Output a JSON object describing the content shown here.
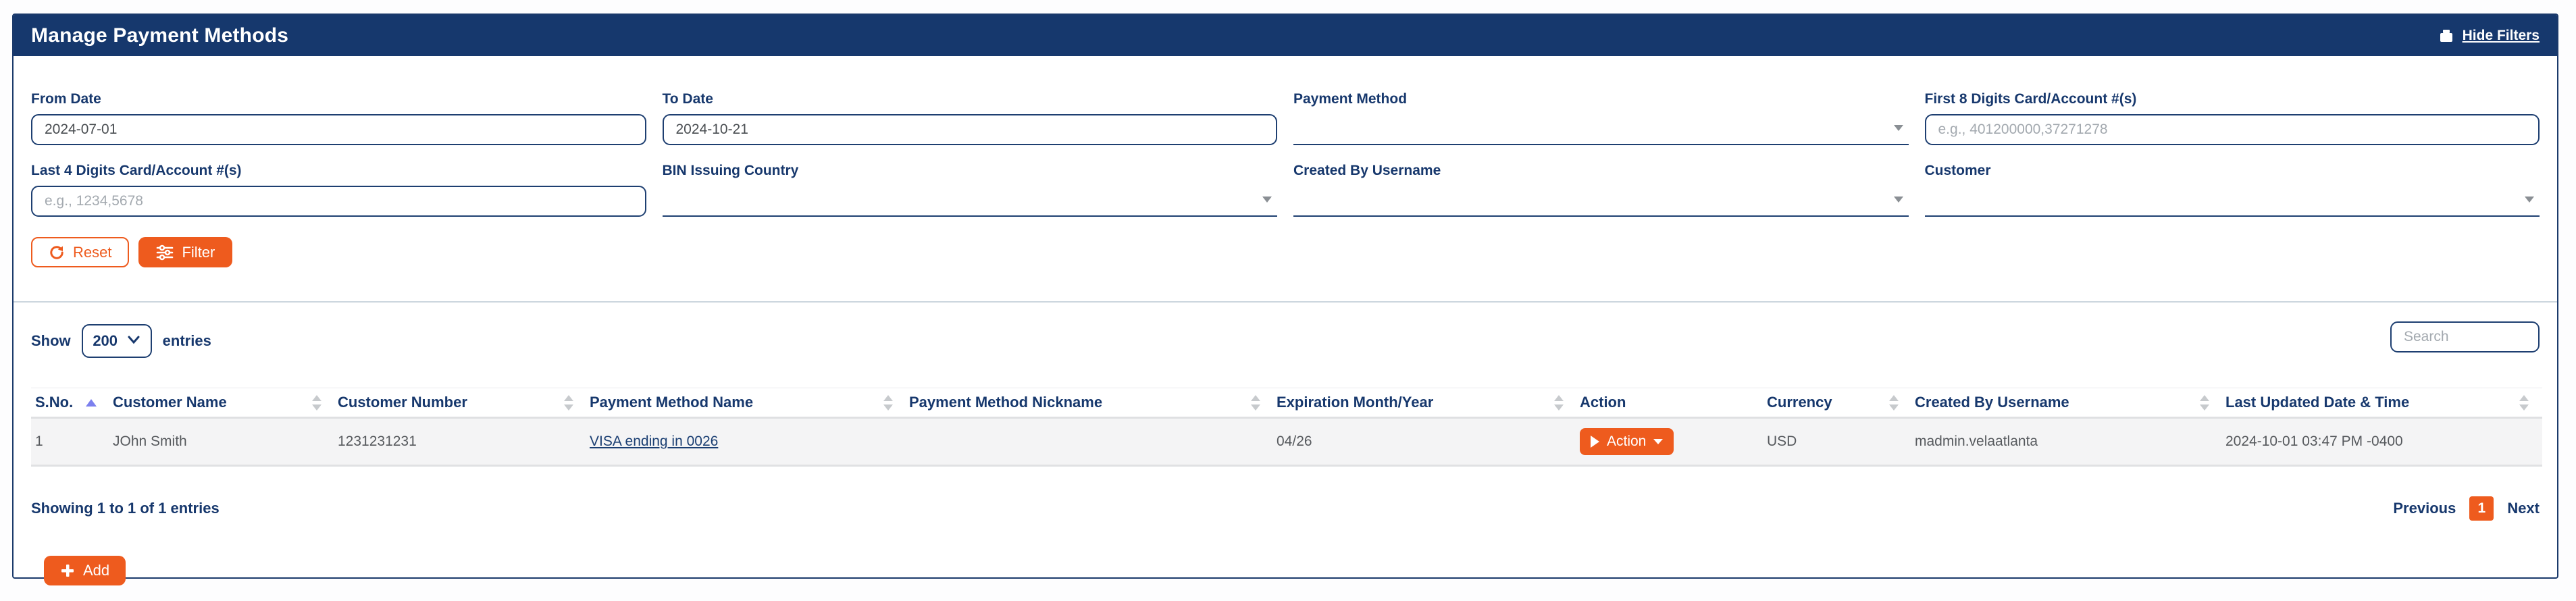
{
  "header": {
    "title": "Manage Payment Methods",
    "hide_filters_label": "Hide Filters"
  },
  "filters": {
    "fields": [
      {
        "label": "From Date",
        "type": "input",
        "value": "2024-07-01",
        "placeholder": ""
      },
      {
        "label": "To Date",
        "type": "input",
        "value": "2024-10-21",
        "placeholder": ""
      },
      {
        "label": "Payment Method",
        "type": "select",
        "value": ""
      },
      {
        "label": "First 8 Digits Card/Account #(s)",
        "type": "input",
        "value": "",
        "placeholder": "e.g., 401200000,37271278"
      },
      {
        "label": "Last 4 Digits Card/Account #(s)",
        "type": "input",
        "value": "",
        "placeholder": "e.g., 1234,5678"
      },
      {
        "label": "BIN Issuing Country",
        "type": "select",
        "value": ""
      },
      {
        "label": "Created By Username",
        "type": "select",
        "value": ""
      },
      {
        "label": "Customer",
        "type": "select",
        "value": ""
      }
    ],
    "reset_label": "Reset",
    "filter_label": "Filter"
  },
  "table_controls": {
    "show_label": "Show",
    "page_size": "200",
    "entries_label": "entries",
    "search_placeholder": "Search"
  },
  "table": {
    "columns": [
      {
        "label": "S.No.",
        "sort": "asc"
      },
      {
        "label": "Customer Name",
        "sort": "both"
      },
      {
        "label": "Customer Number",
        "sort": "both"
      },
      {
        "label": "Payment Method Name",
        "sort": "both"
      },
      {
        "label": "Payment Method Nickname",
        "sort": "both"
      },
      {
        "label": "Expiration Month/Year",
        "sort": "both"
      },
      {
        "label": "Action",
        "sort": "none"
      },
      {
        "label": "Currency",
        "sort": "both"
      },
      {
        "label": "Created By Username",
        "sort": "both"
      },
      {
        "label": "Last Updated Date & Time",
        "sort": "both"
      }
    ],
    "rows": [
      {
        "sno": "1",
        "customer_name": "JOhn Smith",
        "customer_number": "1231231231",
        "payment_method_name": "VISA ending in 0026",
        "payment_method_nickname": "",
        "expiration": "04/26",
        "action_label": "Action",
        "currency": "USD",
        "created_by": "madmin.velaatlanta",
        "last_updated": "2024-10-01 03:47 PM -0400"
      }
    ]
  },
  "footer": {
    "showing_text": "Showing 1 to 1 of 1 entries",
    "previous_label": "Previous",
    "current_page": "1",
    "next_label": "Next",
    "add_label": "Add"
  },
  "colors": {
    "navy": "#16386d",
    "orange": "#ee5b1e",
    "sort_active": "#7c80ee",
    "row_background": "#f4f4f5"
  }
}
